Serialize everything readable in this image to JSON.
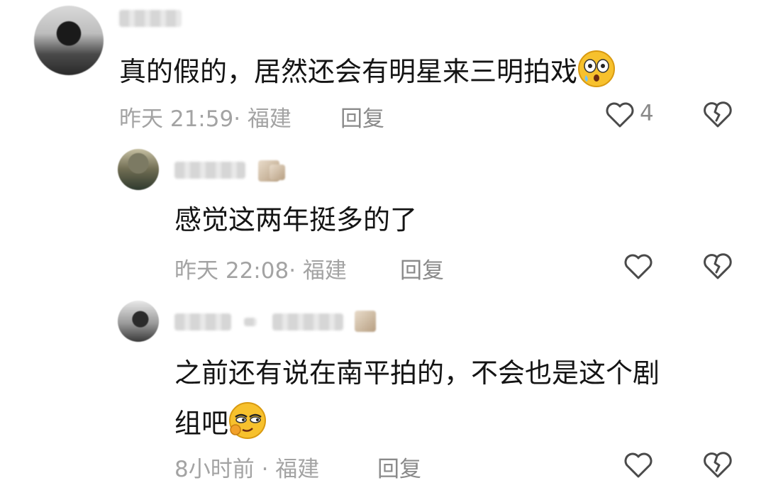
{
  "comments": [
    {
      "text": "真的假的，居然还会有明星来三明拍戏",
      "emoji": "astonished-face",
      "time": "昨天 21:59·",
      "location": "福建",
      "reply": "回复",
      "likes": "4"
    },
    {
      "text": "感觉这两年挺多的了",
      "time": "昨天 22:08·",
      "location": "福建",
      "reply": "回复",
      "likes": ""
    },
    {
      "text_line1": "之前还有说在南平拍的，不会也是这个剧",
      "text_line2": "组吧",
      "emoji": "smirk-face",
      "time": "8小时前 ·",
      "location": "福建",
      "reply": "回复",
      "likes": ""
    }
  ],
  "colors": {
    "text": "#141414",
    "meta": "#a3a3a3",
    "icon": "#4a4a4a"
  }
}
